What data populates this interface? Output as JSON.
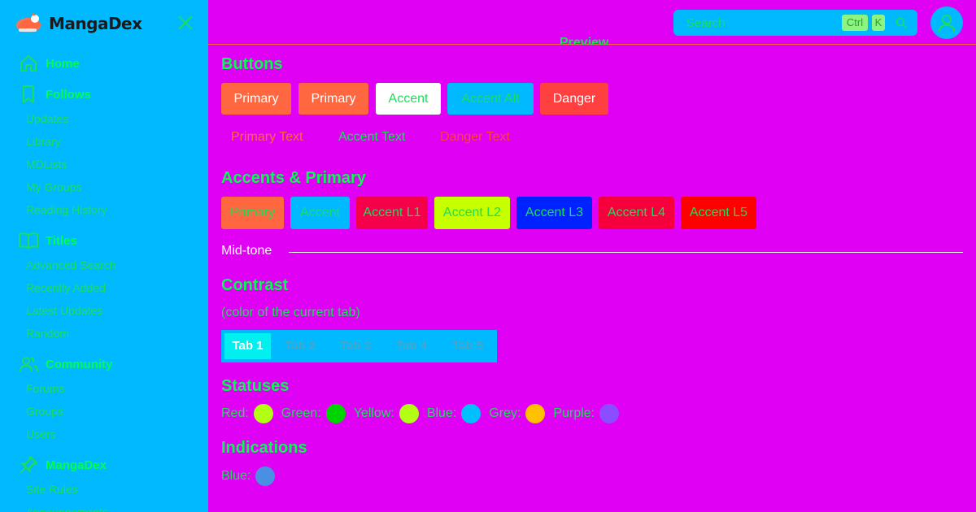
{
  "sidebar": {
    "brand": "MangaDex",
    "sections": [
      {
        "label": "Home",
        "icon": "home-icon"
      },
      {
        "label": "Follows",
        "icon": "bookmark-icon",
        "items": [
          "Updates",
          "Library",
          "MDLists",
          "My Groups",
          "Reading History"
        ]
      },
      {
        "label": "Titles",
        "icon": "book-open-icon",
        "items": [
          "Advanced Search",
          "Recently Added",
          "Latest Updates",
          "Random"
        ]
      },
      {
        "label": "Community",
        "icon": "users-icon",
        "items": [
          "Forums",
          "Groups",
          "Users"
        ]
      },
      {
        "label": "MangaDex",
        "icon": "pin-icon",
        "items": [
          "Site Rules",
          "Announcements"
        ]
      }
    ]
  },
  "header": {
    "search_placeholder": "Search",
    "kbd_ctrl": "Ctrl",
    "kbd_k": "K",
    "preview_title": "Preview"
  },
  "buttons": {
    "title": "Buttons",
    "row1": [
      {
        "label": "Primary",
        "bg": "#ff6740",
        "color": "#ffffff"
      },
      {
        "label": "Primary",
        "bg": "#ff6740",
        "color": "#ffffff"
      },
      {
        "label": "Accent",
        "bg": "#ffffff",
        "color": "#1cde5a"
      },
      {
        "label": "Accent Alt",
        "bg": "#00b9ff",
        "color": "#1cde5a"
      },
      {
        "label": "Danger",
        "bg": "#ff4040",
        "color": "#ffffff"
      }
    ],
    "row2": [
      {
        "label": "Primary Text",
        "color": "#ff6740"
      },
      {
        "label": "Accent Text",
        "color": "#1cde5a"
      },
      {
        "label": "Danger Text",
        "color": "#ff4040"
      }
    ]
  },
  "accents": {
    "title": "Accents & Primary",
    "swatches": [
      {
        "label": "Primary",
        "bg": "#ff6740"
      },
      {
        "label": "Accent",
        "bg": "#00b9ff"
      },
      {
        "label": "Accent L1",
        "bg": "#f5004a"
      },
      {
        "label": "Accent L2",
        "bg": "#c6ff00"
      },
      {
        "label": "Accent L3",
        "bg": "#0022ff"
      },
      {
        "label": "Accent L4",
        "bg": "#f5003c"
      },
      {
        "label": "Accent L5",
        "bg": "#ff0000"
      }
    ],
    "midtone": "Mid-tone"
  },
  "contrast": {
    "title": "Contrast",
    "subtitle": "(color of the current tab)",
    "tabs": [
      "Tab 1",
      "Tab 2",
      "Tab 3",
      "Tab 4",
      "Tab 5"
    ]
  },
  "statuses": {
    "title": "Statuses",
    "items": [
      {
        "label": "Red:",
        "color": "#b3ff14"
      },
      {
        "label": "Green:",
        "color": "#00d400"
      },
      {
        "label": "Yellow:",
        "color": "#b3ff14"
      },
      {
        "label": "Blue:",
        "color": "#00bfff"
      },
      {
        "label": "Grey:",
        "color": "#ffc100"
      },
      {
        "label": "Purple:",
        "color": "#8b4dff"
      }
    ]
  },
  "indications": {
    "title": "Indications",
    "items": [
      {
        "label": "Blue:",
        "color": "#4a90e2"
      }
    ]
  }
}
